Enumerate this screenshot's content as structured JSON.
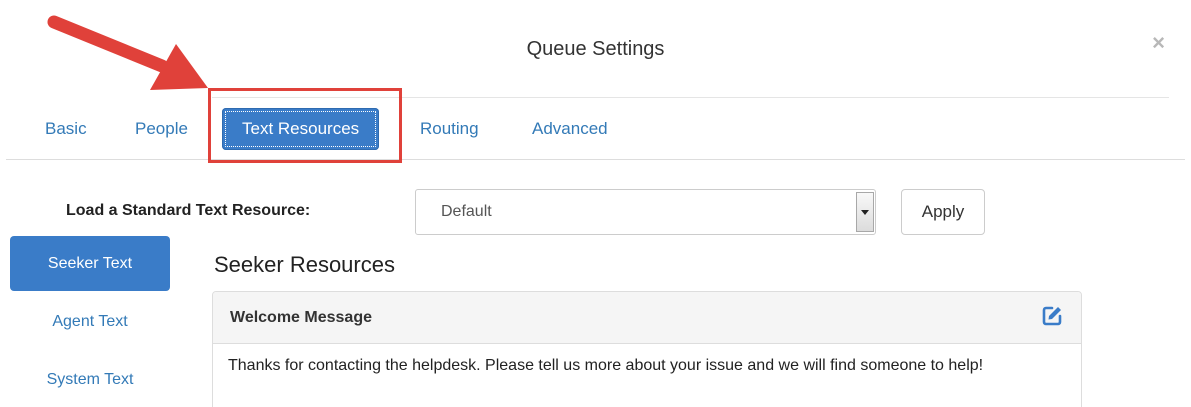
{
  "dialog": {
    "title": "Queue Settings",
    "close_label": "×"
  },
  "tabs": [
    {
      "label": "Basic",
      "active": false
    },
    {
      "label": "People",
      "active": false
    },
    {
      "label": "Text Resources",
      "active": true
    },
    {
      "label": "Routing",
      "active": false
    },
    {
      "label": "Advanced",
      "active": false
    }
  ],
  "load_resource": {
    "label": "Load a Standard Text Resource:",
    "selected_value": "Default",
    "apply_label": "Apply"
  },
  "side_nav": [
    {
      "label": "Seeker Text",
      "active": true
    },
    {
      "label": "Agent Text",
      "active": false
    },
    {
      "label": "System Text",
      "active": false
    }
  ],
  "section": {
    "title": "Seeker Resources"
  },
  "panel": {
    "title": "Welcome Message",
    "body": "Thanks for contacting the helpdesk. Please tell us more about your issue and we will find someone to help!"
  },
  "colors": {
    "accent": "#3a7cc8",
    "link": "#337ab7",
    "annotation": "#e0413a"
  },
  "icons": {
    "close": "close-icon",
    "edit": "edit-icon",
    "annotation_arrow": "arrow-annotation-icon"
  }
}
